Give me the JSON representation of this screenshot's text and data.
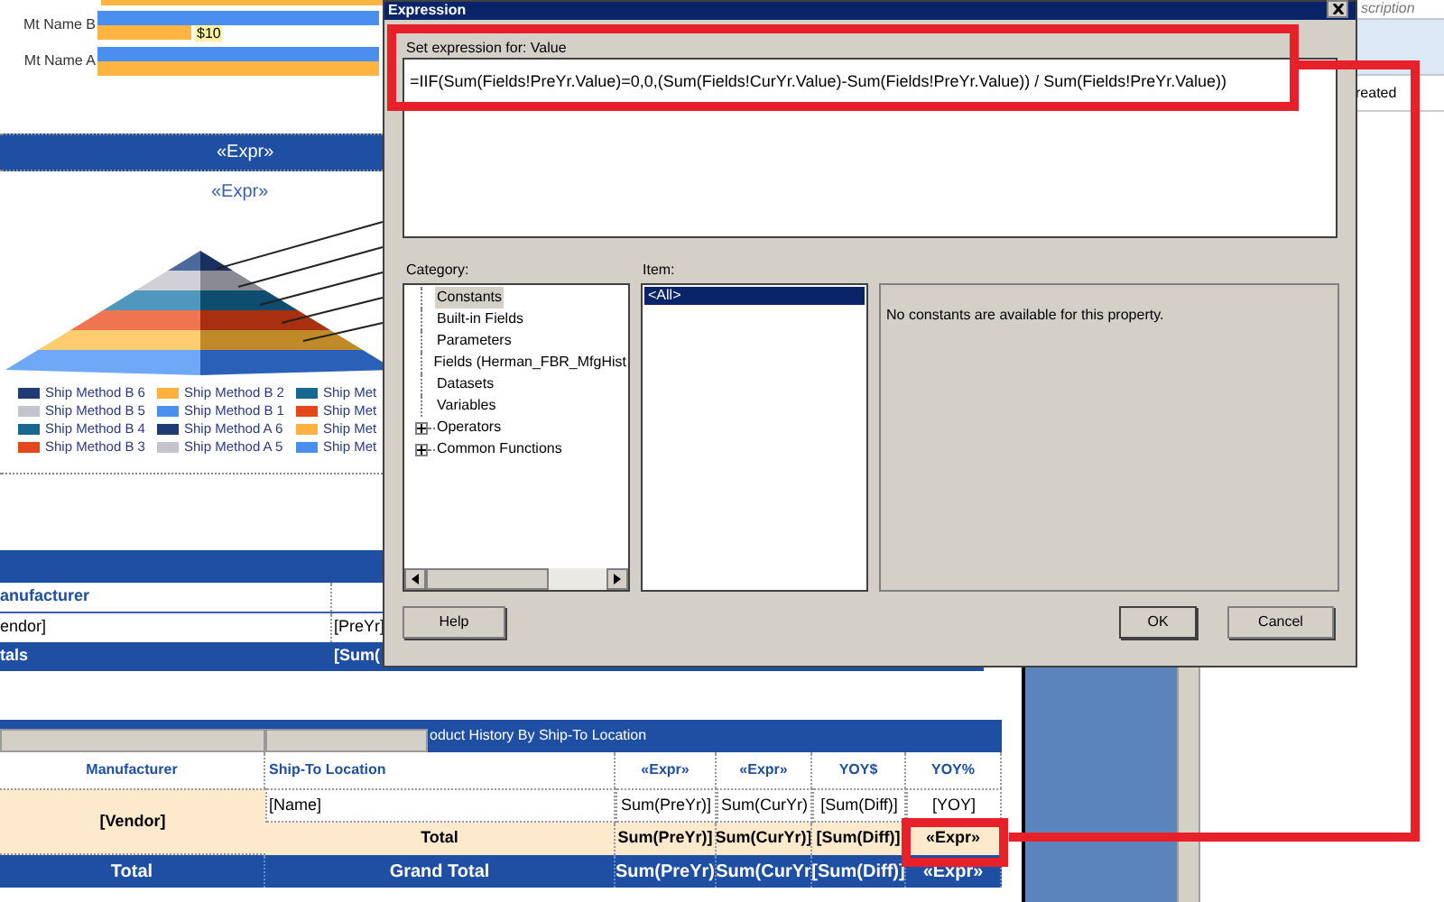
{
  "bar_chart": {
    "rows": [
      {
        "label": "Mt Name B",
        "tooltip": "$10"
      },
      {
        "label": "Mt Name A"
      }
    ]
  },
  "band_title": "«Expr»",
  "chart_title": "«Expr»",
  "legend": [
    {
      "label": "Ship Method B 6",
      "color": "#1f3b73"
    },
    {
      "label": "Ship Method B 5",
      "color": "#c4c4cc"
    },
    {
      "label": "Ship Method B 4",
      "color": "#17688f"
    },
    {
      "label": "Ship Method B 3",
      "color": "#e4481a"
    },
    {
      "label": "Ship Method B 2",
      "color": "#ffb040"
    },
    {
      "label": "Ship Method B 1",
      "color": "#4a8ff0"
    },
    {
      "label": "Ship Method A 6",
      "color": "#1f3b73"
    },
    {
      "label": "Ship Method A 5",
      "color": "#c4c4cc"
    },
    {
      "label": "Ship Met",
      "color": "#17688f"
    },
    {
      "label": "Ship Met",
      "color": "#e4481a"
    },
    {
      "label": "Ship Met",
      "color": "#ffb040"
    },
    {
      "label": "Ship Met",
      "color": "#4a8ff0"
    }
  ],
  "vendor_table": {
    "header": "anufacturer",
    "detail": [
      "endor]",
      "[PreYr]"
    ],
    "totals": [
      "tals",
      "[Sum("
    ]
  },
  "history_table": {
    "title": "oduct History By Ship-To Location",
    "columns": [
      "Manufacturer",
      "Ship-To Location",
      "«Expr»",
      "«Expr»",
      "YOY$",
      "YOY%"
    ],
    "group": "[Vendor]",
    "detail": [
      "[Name]",
      "Sum(PreYr)]",
      "Sum(CurYr)",
      "[Sum(Diff)]",
      "[YOY]"
    ],
    "subtotal": [
      "Total",
      "Sum(PreYr)]",
      "Sum(CurYr)]",
      "[Sum(Diff)]",
      "«Expr»"
    ],
    "grand_total": [
      "Total",
      "Grand Total",
      "Sum(PreYr)",
      "Sum(CurYr",
      "[Sum(Diff)]",
      "«Expr»"
    ]
  },
  "right_panel": {
    "header": "scription",
    "column": "reated"
  },
  "dialog": {
    "title": "Expression",
    "prompt": "Set expression for: Value",
    "expression": "=IIF(Sum(Fields!PreYr.Value)=0,0,(Sum(Fields!CurYr.Value)-Sum(Fields!PreYr.Value)) / Sum(Fields!PreYr.Value))",
    "category_label": "Category:",
    "categories": [
      {
        "label": "Constants",
        "selected": true,
        "expandable": false
      },
      {
        "label": "Built-in Fields",
        "selected": false,
        "expandable": false
      },
      {
        "label": "Parameters",
        "selected": false,
        "expandable": false
      },
      {
        "label": "Fields (Herman_FBR_MfgHist",
        "selected": false,
        "expandable": false
      },
      {
        "label": "Datasets",
        "selected": false,
        "expandable": false
      },
      {
        "label": "Variables",
        "selected": false,
        "expandable": false
      },
      {
        "label": "Operators",
        "selected": false,
        "expandable": true
      },
      {
        "label": "Common Functions",
        "selected": false,
        "expandable": true
      }
    ],
    "item_label": "Item:",
    "items": [
      {
        "label": "<All>",
        "selected": true
      }
    ],
    "description": "No constants are available for this property.",
    "help": "Help",
    "ok": "OK",
    "cancel": "Cancel"
  }
}
